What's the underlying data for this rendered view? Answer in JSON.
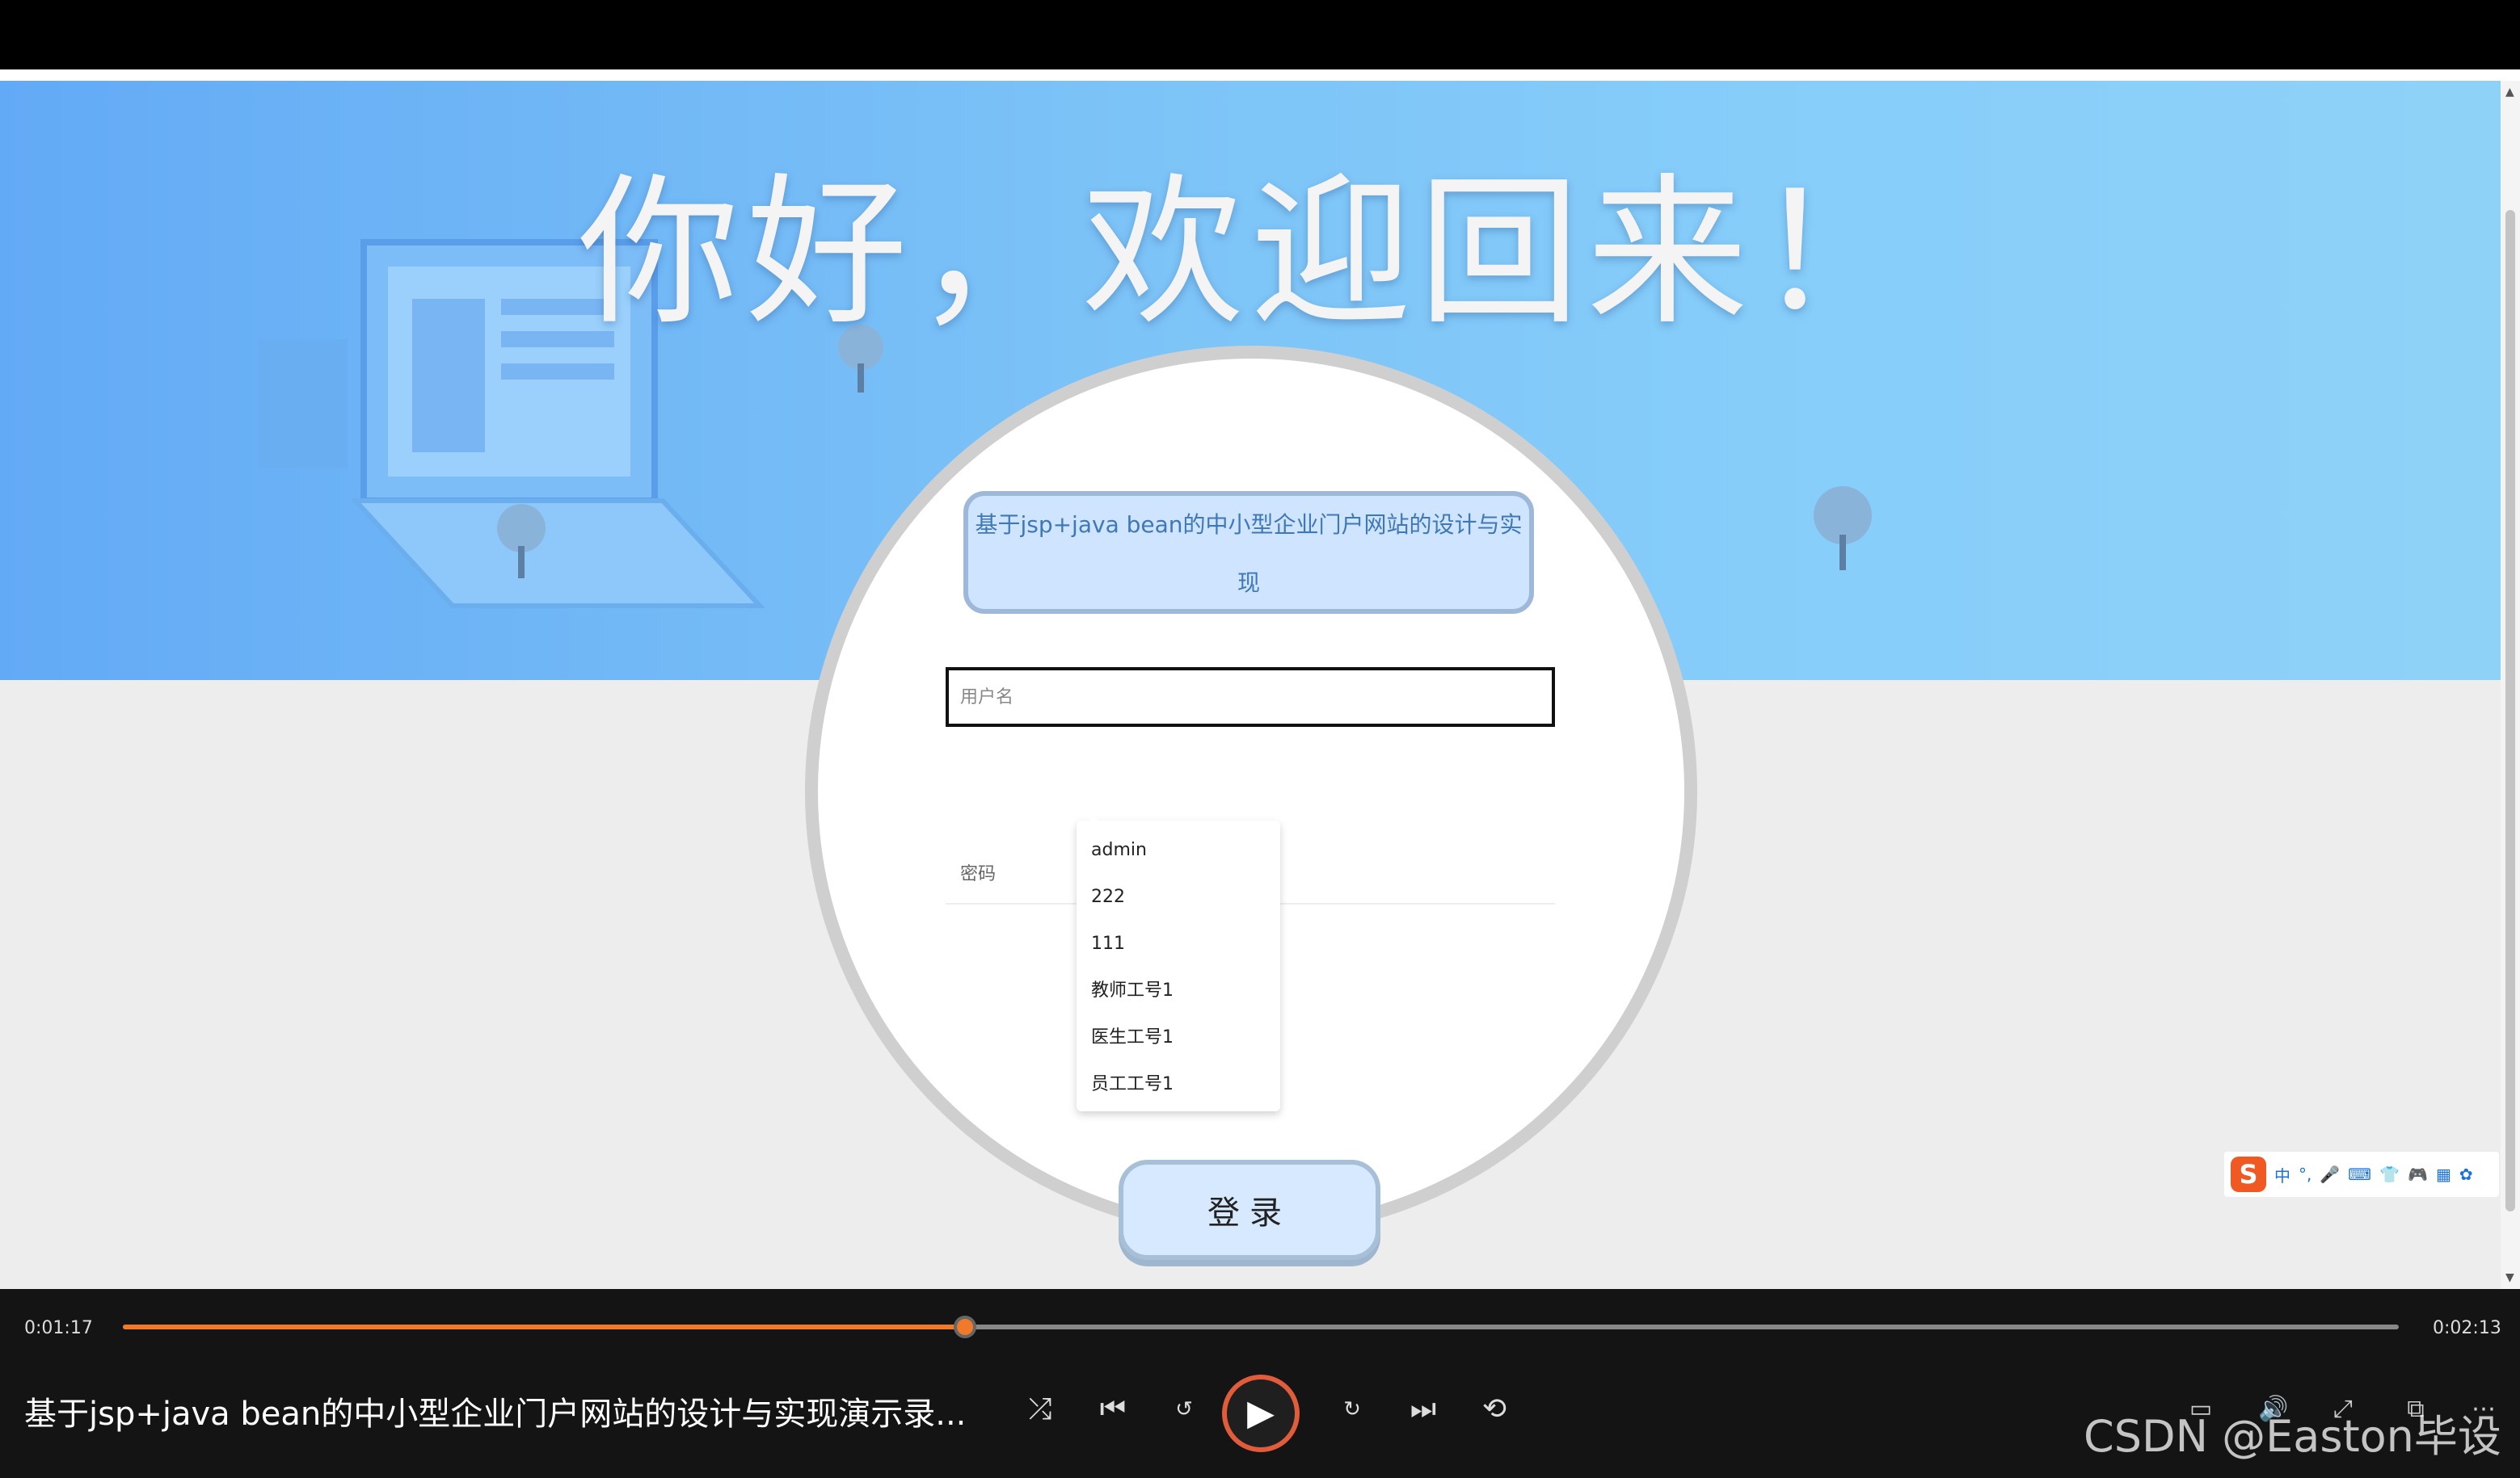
{
  "page": {
    "welcome_heading": "你好，欢迎回来！",
    "system_title": "基于jsp+java bean的中小型企业门户网站的设计与实现",
    "username_placeholder": "用户名",
    "password_label": "密码",
    "login_button": "登录",
    "autocomplete_options": [
      "admin",
      "222",
      "111",
      "教师工号1",
      "医生工号1",
      "员工工号1"
    ]
  },
  "ime": {
    "logo": "S",
    "items": [
      "中",
      "°,",
      "🎤",
      "⌨",
      "👕",
      "🎮",
      "▦",
      "✿"
    ]
  },
  "player": {
    "current_time": "0:01:17",
    "total_time": "0:02:13",
    "progress_fraction": 0.37,
    "video_title": "基于jsp+java bean的中小型企业门户网站的设计与实现演示录...",
    "accent_color": "#f07a2a"
  },
  "watermark": "CSDN @Easton毕设"
}
